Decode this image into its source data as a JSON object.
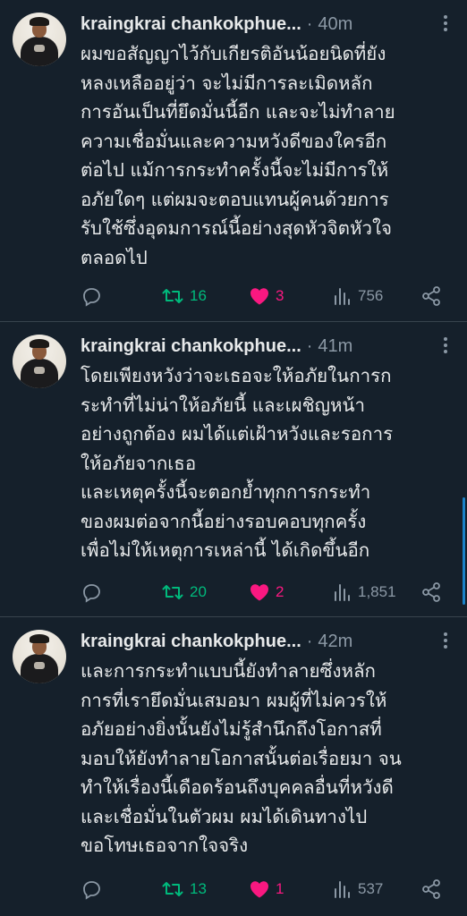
{
  "tweets": [
    {
      "author": "kraingkrai chankokphue...",
      "time": "40m",
      "text": "ผมขอสัญญาไว้กับเกียรติอันน้อยนิดที่ยัง\nหลงเหลืออยู่ว่า จะไม่มีการละเมิดหลัก\nการอันเป็นที่ยึดมั่นนี้อีก และจะไม่ทำลาย\nความเชื่อมั่นและความหวังดีของใครอีก\nต่อไป แม้การกระทำครั้งนี้จะไม่มีการให้\nอภัยใดๆ แต่ผมจะตอบแทนผู้คนด้วยการ\nรับใช้ซึ่งอุดมการณ์นี้อย่างสุดหัวจิตหัวใจ\nตลอดไป",
      "retweets": "16",
      "likes": "3",
      "views": "756"
    },
    {
      "author": "kraingkrai chankokphue...",
      "time": "41m",
      "text": "โดยเพียงหวังว่าจะเธอจะให้อภัยในการก\nระทำที่ไม่น่าให้อภัยนี้ และเผชิญหน้า\nอย่างถูกต้อง ผมได้แต่เฝ้าหวังและรอการ\nให้อภัยจากเธอ\n และเหตุครั้งนี้จะตอกย้ำทุกการกระทำ\nของผมต่อจากนี้อย่างรอบคอบทุกครั้ง\nเพื่อไม่ให้เหตุการเหล่านี้ ได้เกิดขึ้นอีก",
      "retweets": "20",
      "likes": "2",
      "views": "1,851"
    },
    {
      "author": "kraingkrai chankokphue...",
      "time": "42m",
      "text": "และการกระทำแบบนี้ยังทำลายซึ่งหลัก\nการที่เรายึดมั่นเสมอมา ผมผู้ที่ไม่ควรให้\nอภัยอย่างยิ่งนั้นยังไม่รู้สำนึกถึงโอกาสที่\nมอบให้ยังทำลายโอกาสนั้นต่อเรื่อยมา จน\nทำให้เรื่องนี้เดือดร้อนถึงบุคคลอื่นที่หวังดี\nและเชื่อมั่นในตัวผม  ผมได้เดินทางไป\nขอโทษเธอจากใจจริง",
      "retweets": "13",
      "likes": "1",
      "views": "537"
    }
  ],
  "theme": {
    "background": "#15202b",
    "retweet_color": "#00ba7c",
    "like_color": "#f91880",
    "muted": "#8b98a5",
    "accent": "#1d9bf0"
  },
  "icons": {
    "reply": "reply-icon",
    "retweet": "retweet-icon",
    "like": "heart-icon",
    "views": "views-icon",
    "share": "share-icon",
    "more": "more-icon"
  }
}
